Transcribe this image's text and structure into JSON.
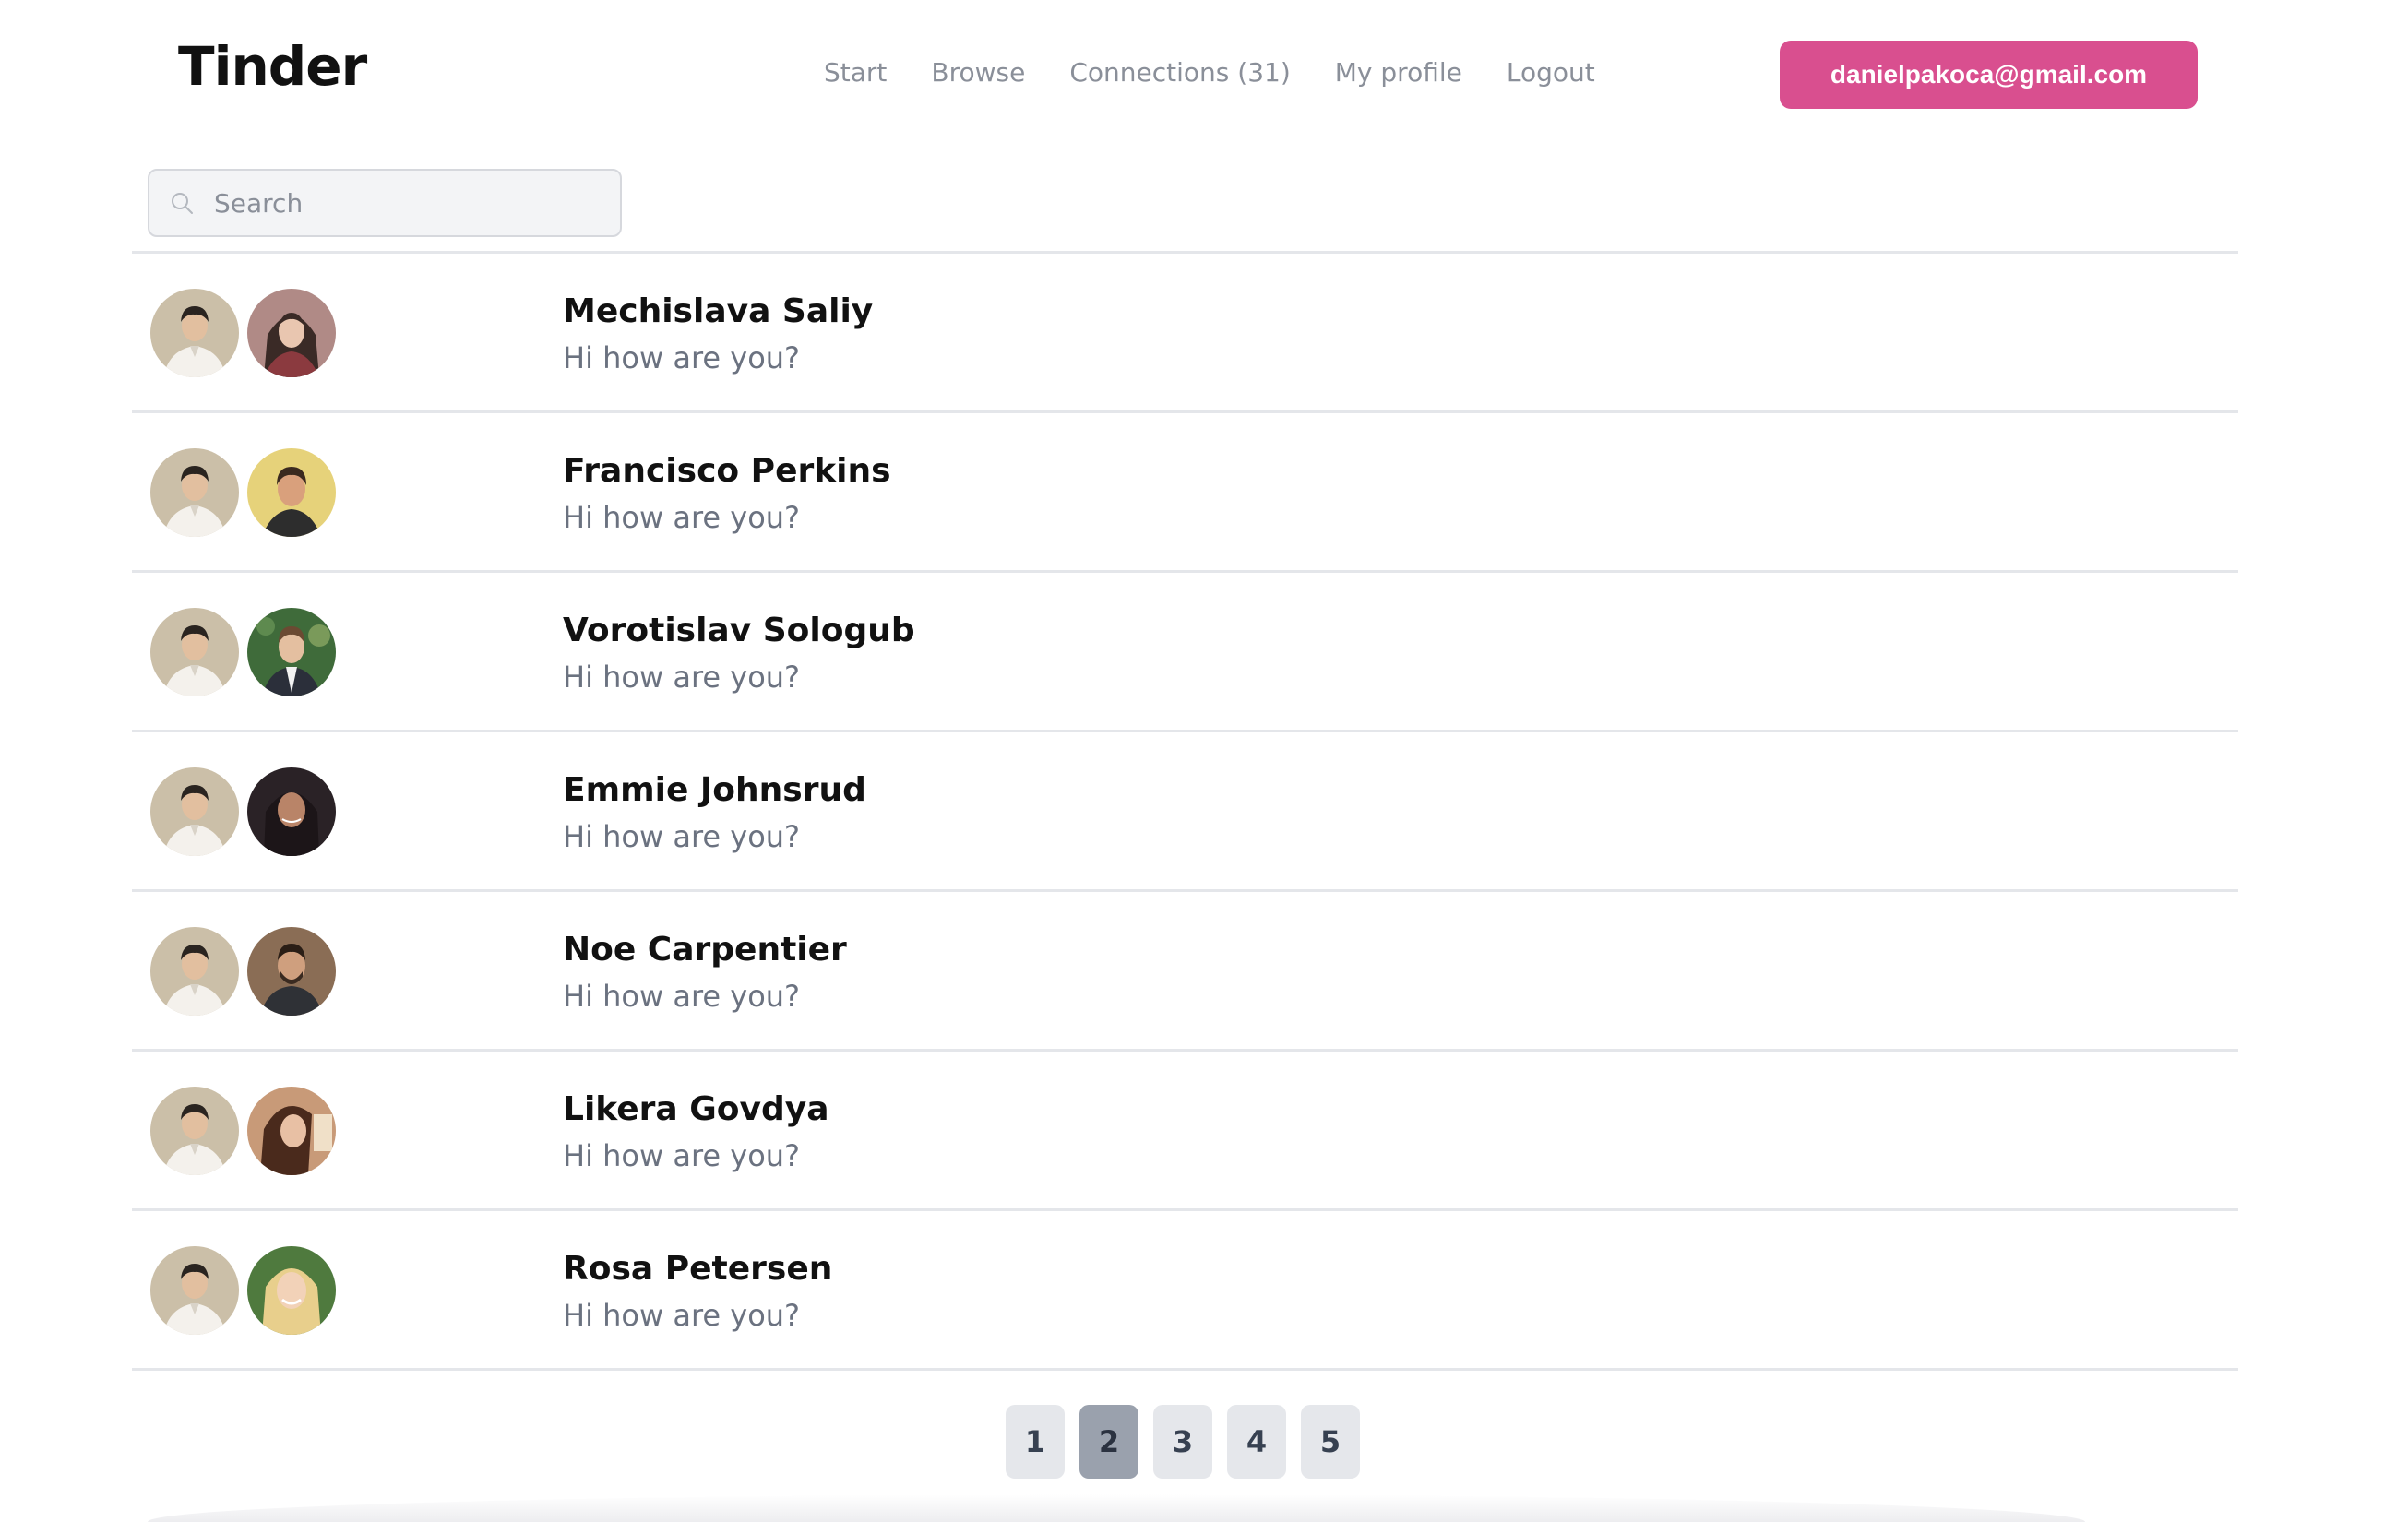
{
  "header": {
    "logo": "Tinder",
    "nav": [
      {
        "label": "Start"
      },
      {
        "label": "Browse"
      },
      {
        "label": "Connections (31)"
      },
      {
        "label": "My profile"
      },
      {
        "label": "Logout"
      }
    ],
    "account_email": "danielpakoca@gmail.com",
    "accent_color": "#d94f8f"
  },
  "search": {
    "placeholder": "Search",
    "value": ""
  },
  "connections": [
    {
      "name": "Mechislava Saliy",
      "message": "Hi how are you?"
    },
    {
      "name": "Francisco Perkins",
      "message": "Hi how are you?"
    },
    {
      "name": "Vorotislav Sologub",
      "message": "Hi how are you?"
    },
    {
      "name": "Emmie Johnsrud",
      "message": "Hi how are you?"
    },
    {
      "name": "Noe Carpentier",
      "message": "Hi how are you?"
    },
    {
      "name": "Likera Govdya",
      "message": "Hi how are you?"
    },
    {
      "name": "Rosa Petersen",
      "message": "Hi how are you?"
    }
  ],
  "pagination": {
    "pages": [
      "1",
      "2",
      "3",
      "4",
      "5"
    ],
    "current": "2"
  }
}
